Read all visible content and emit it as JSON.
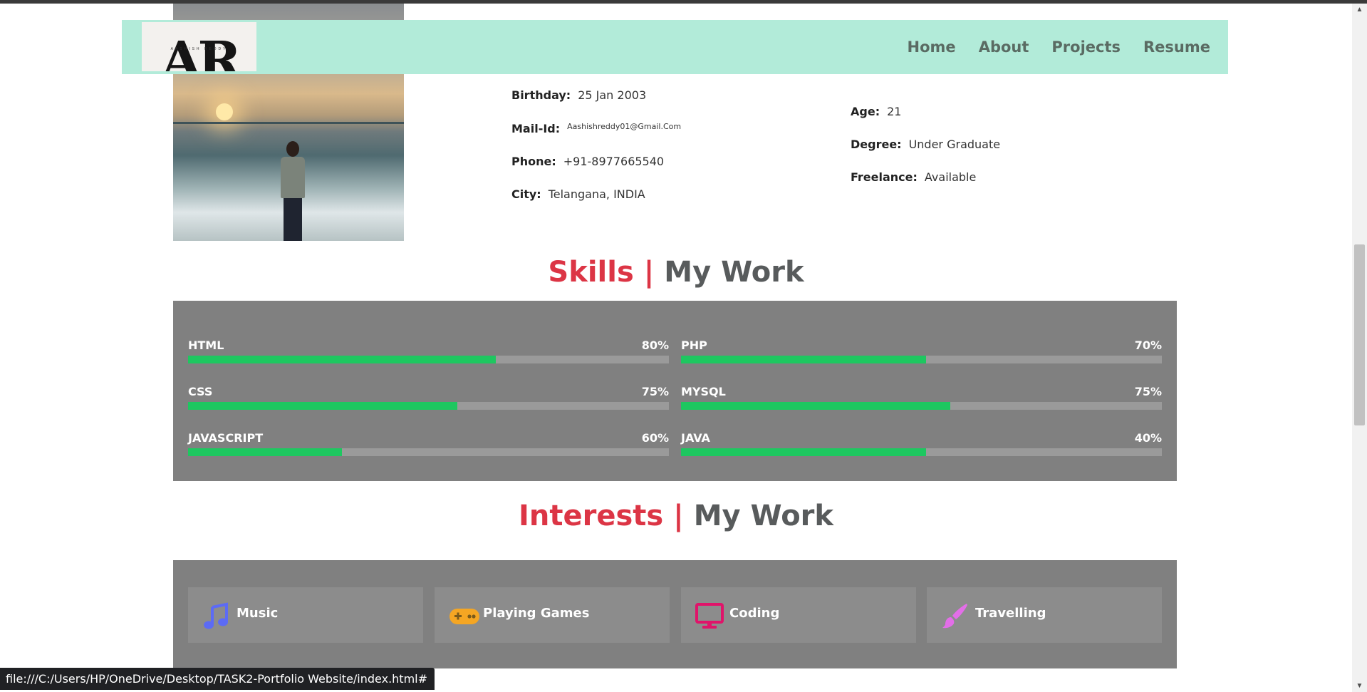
{
  "header": {
    "logo_text": "AR",
    "logo_subtext": "AASHISH REDDY",
    "nav": [
      {
        "label": "Home"
      },
      {
        "label": "About"
      },
      {
        "label": "Projects"
      },
      {
        "label": "Resume"
      }
    ]
  },
  "profile": {
    "left": [
      {
        "key": "Birthday:",
        "value": "25 Jan 2003"
      },
      {
        "key": "Mail-Id:",
        "value": "Aashishreddy01@Gmail.Com"
      },
      {
        "key": "Phone:",
        "value": "+91-8977665540"
      },
      {
        "key": "City:",
        "value": "Telangana, INDIA"
      }
    ],
    "right": [
      {
        "key": "Age:",
        "value": "21"
      },
      {
        "key": "Degree:",
        "value": "Under Graduate"
      },
      {
        "key": "Freelance:",
        "value": "Available"
      }
    ]
  },
  "skills_section": {
    "title_accent": "Skills",
    "separator": "|",
    "title_rest": "My Work",
    "items": [
      {
        "name": "HTML",
        "percent_label": "80%",
        "bar_fill_pct": 64
      },
      {
        "name": "PHP",
        "percent_label": "70%",
        "bar_fill_pct": 51
      },
      {
        "name": "CSS",
        "percent_label": "75%",
        "bar_fill_pct": 56
      },
      {
        "name": "MYSQL",
        "percent_label": "75%",
        "bar_fill_pct": 56
      },
      {
        "name": "JAVASCRIPT",
        "percent_label": "60%",
        "bar_fill_pct": 32
      },
      {
        "name": "JAVA",
        "percent_label": "40%",
        "bar_fill_pct": 51
      }
    ]
  },
  "interests_section": {
    "title_accent": "Interests",
    "separator": "|",
    "title_rest": "My Work",
    "items": [
      {
        "label": "Music",
        "icon": "music-note-icon",
        "color": "#5c6bf5"
      },
      {
        "label": "Playing Games",
        "icon": "gamepad-icon",
        "color": "#f5a623"
      },
      {
        "label": "Coding",
        "icon": "monitor-icon",
        "color": "#e0146a"
      },
      {
        "label": "Travelling",
        "icon": "paintbrush-icon",
        "color": "#e36ee8"
      }
    ]
  },
  "status_bar": {
    "url": "file:///C:/Users/HP/OneDrive/Desktop/TASK2-Portfolio Website/index.html#"
  },
  "colors": {
    "header_bg": "#b2ebd9",
    "accent_red": "#dc3545",
    "panel_grey": "#808080",
    "progress_green": "#1ec760"
  }
}
